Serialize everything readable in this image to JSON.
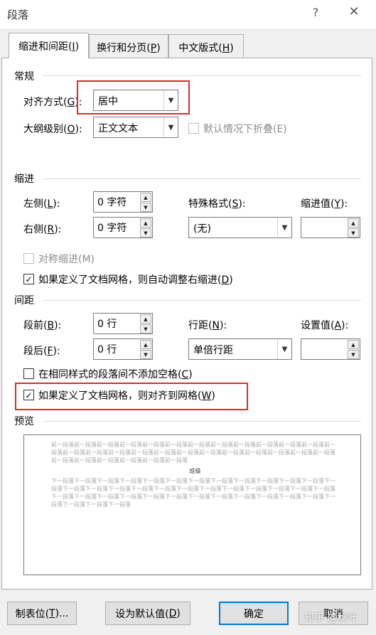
{
  "window": {
    "title": "段落",
    "help": "?",
    "close": "✕"
  },
  "tabs": [
    {
      "label": "缩进和间距(",
      "hot": "I",
      "end": ")"
    },
    {
      "label": "换行和分页(",
      "hot": "P",
      "end": ")"
    },
    {
      "label": "中文版式(",
      "hot": "H",
      "end": ")"
    }
  ],
  "general": {
    "heading": "常规",
    "alignment_label": "对齐方式(",
    "alignment_hot": "G",
    "alignment_end": "):",
    "alignment_value": "居中",
    "outline_label": "大纲级别(",
    "outline_hot": "O",
    "outline_end": "):",
    "outline_value": "正文文本",
    "collapse_label": "默认情况下折叠(E)"
  },
  "indent": {
    "heading": "缩进",
    "left_label": "左侧(",
    "left_hot": "L",
    "left_end": "):",
    "left_value": "0 字符",
    "right_label": "右侧(",
    "right_hot": "R",
    "right_end": "):",
    "right_value": "0 字符",
    "special_label": "特殊格式(",
    "special_hot": "S",
    "special_end": "):",
    "special_value": "(无)",
    "by_label": "缩进值(",
    "by_hot": "Y",
    "by_end": "):",
    "by_value": "",
    "mirror_label": "对称缩进(M)",
    "auto_adjust_label": "如果定义了文档网格，则自动调整右缩进(",
    "auto_adjust_hot": "D",
    "auto_adjust_end": ")"
  },
  "spacing": {
    "heading": "间距",
    "before_label": "段前(",
    "before_hot": "B",
    "before_end": "):",
    "before_value": "0 行",
    "after_label": "段后(",
    "after_hot": "F",
    "after_end": "):",
    "after_value": "0 行",
    "line_label": "行距(",
    "line_hot": "N",
    "line_end": "):",
    "line_value": "单倍行距",
    "at_label": "设置值(",
    "at_hot": "A",
    "at_end": "):",
    "at_value": "",
    "no_space_label": "在相同样式的段落间不添加空格(",
    "no_space_hot": "C",
    "no_space_end": ")",
    "snap_grid_label": "如果定义了文档网格，则对齐到网格(",
    "snap_grid_hot": "W",
    "snap_grid_end": ")"
  },
  "preview": {
    "heading": "预览",
    "prev_text": "前一段落前一段落前一段落前一段落前一段落前一段落前一段落前一段落前一段落前一段落前一段落前一段落前一段落前一段落前一段落前一段落前一段落前一段落前一段落前一段落前一段落前一段落前一段落前一段落前一段落前一段落前一段落前一段落前一段落前一段落前一段落",
    "sample": "班级",
    "next_text": "下一段落下一段落下一段落下一段落下一段落下一段落下一段落下一段落下一段落下一段落下一段落下一段落下一段落下一段落下一段落下一段落下一段落下一段落下一段落下一段落下一段落下一段落下一段落下一段落下一段落下一段落下一段落下一段落下一段落下一段落下一段落下一段落下一段落下一段落下一段落下一段落下一段落下一段落下一段落下一段落下一段落"
  },
  "buttons": {
    "tabs_label": "制表位(",
    "tabs_hot": "T",
    "tabs_end": ")...",
    "default_label": "设为默认值(",
    "default_hot": "D",
    "default_end": ")",
    "ok": "确定",
    "cancel": "取消"
  },
  "watermark": "知乎 @秋叶",
  "colors": {
    "highlight": "#e02b2b",
    "accent": "#0078d7"
  }
}
